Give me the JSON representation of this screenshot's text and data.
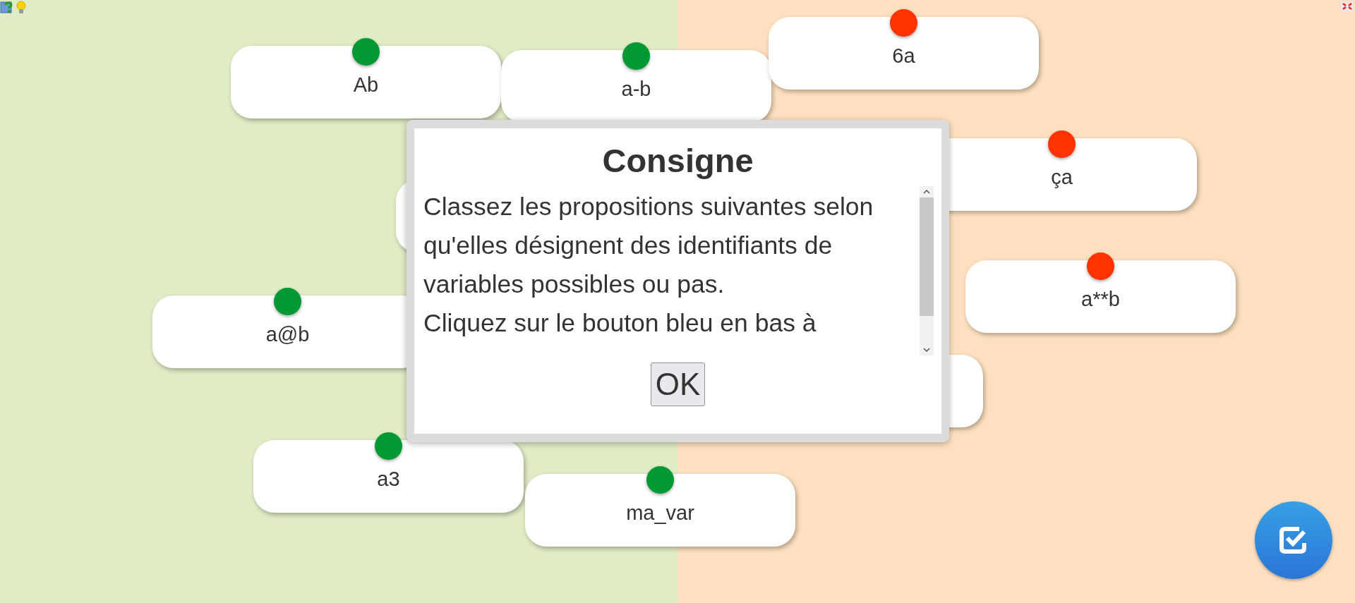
{
  "cards": [
    {
      "label": "Ab",
      "color": "#009933"
    },
    {
      "label": "a-b",
      "color": "#009933"
    },
    {
      "label": "6a",
      "color": "#ff3300"
    },
    {
      "label": "ça",
      "color": "#ff3300"
    },
    {
      "label": "a**b",
      "color": "#ff3300"
    },
    {
      "label": "a@b",
      "color": "#009933"
    },
    {
      "label": "a3",
      "color": "#009933"
    },
    {
      "label": "ma_var",
      "color": "#009933"
    }
  ],
  "dialog": {
    "title": "Consigne",
    "paragraphs": [
      "Classez les propositions suivantes selon qu'elles désignent des identifiants de variables possibles ou pas.",
      "Cliquez sur le bouton bleu en bas à"
    ],
    "button": "OK"
  }
}
